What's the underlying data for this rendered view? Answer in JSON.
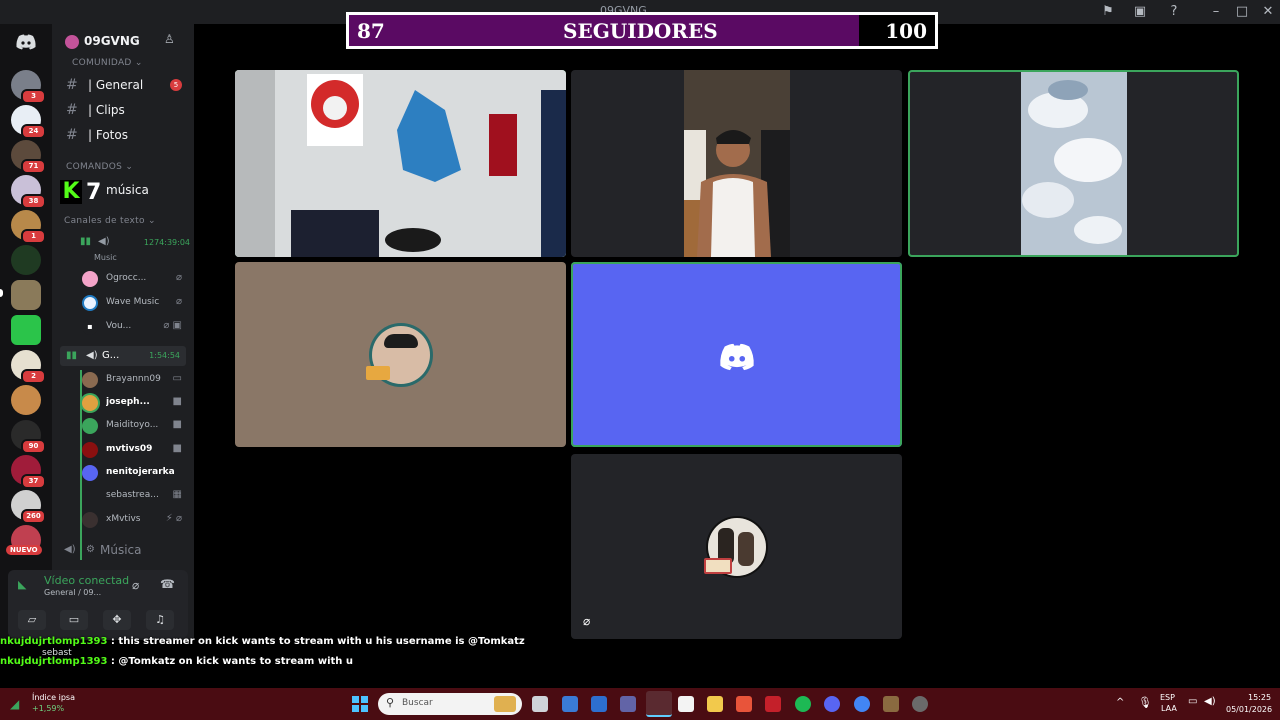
{
  "window": {
    "title": "09GVNG"
  },
  "overlay": {
    "followers_current": "87",
    "followers_goal": "100",
    "followers_label": "SEGUIDORES",
    "followers_progress_fraction": 0.87
  },
  "server_rail": {
    "badges": [
      "3",
      "24",
      "71",
      "38",
      "1",
      "2",
      "90",
      "37",
      "260"
    ],
    "new_label": "NUEVO"
  },
  "sidebar": {
    "server_name": "09GVNG",
    "categories": {
      "community": "COMUNIDAD",
      "commands": "COMANDOS",
      "text_channels": "Canales de texto"
    },
    "channels": [
      {
        "label": "| General",
        "badge": "5"
      },
      {
        "label": "| Clips"
      },
      {
        "label": "| Fotos"
      }
    ],
    "music_channel": "música",
    "kick_logo": "K",
    "kick_number": "7",
    "voice1": {
      "timer": "1274:39:04",
      "sub": "Music"
    },
    "voice1_members": [
      "Ogrocc...",
      "Wave Music",
      "Vou..."
    ],
    "voice2": {
      "name": "G...",
      "timer": "1:54:54"
    },
    "voice2_members": [
      "Brayannn09",
      "joseph...",
      "Maiditoyo...",
      "mvtivs09",
      "nenitojerarka",
      "sebastrea...",
      "xMvtivs"
    ],
    "music_voice": "Música"
  },
  "voice_panel": {
    "status": "Vídeo conectad",
    "location": "General / 09...",
    "overlap_user": "sebast"
  },
  "chat": [
    {
      "user": "nkujdujrtlomp1393",
      "text": " : this streamer on kick wants to stream with u his username is @Tomkatz"
    },
    {
      "user": "nkujdujrtlomp1393",
      "text": " : @Tomkatz on kick wants to stream with u"
    }
  ],
  "taskbar": {
    "widget_title": "Índice ipsa",
    "widget_value": "+1,59%",
    "search_placeholder": "Buscar",
    "lang_top": "ESP",
    "lang_bottom": "LAA",
    "time": "15:25",
    "date": "05/01/2026"
  },
  "colors": {
    "accent": "#5865f2",
    "speaking": "#3ba55c",
    "kick_green": "#53fc18",
    "follower_fill": "#5a0a63",
    "taskbar": "#4a0c12"
  }
}
